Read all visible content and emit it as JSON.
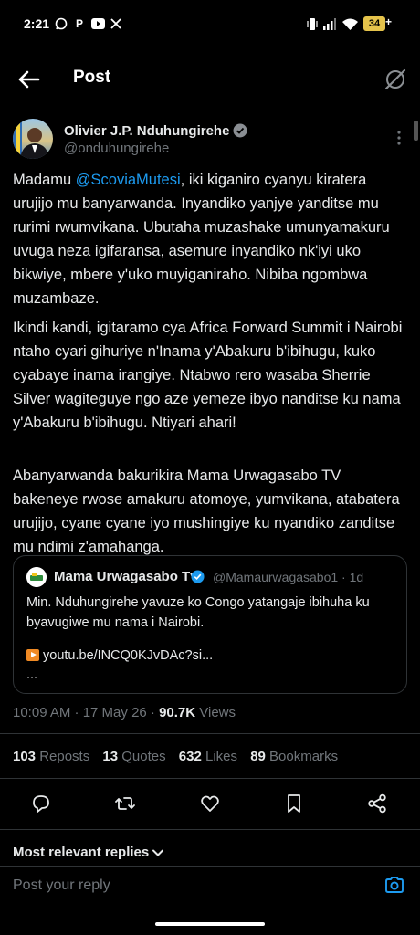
{
  "status_bar": {
    "time": "2:21",
    "battery": "34",
    "battery_suffix": "+",
    "app_icons": [
      "whatsapp-icon",
      "p-icon",
      "youtube-icon",
      "x-icon"
    ]
  },
  "header": {
    "title": "Post"
  },
  "author": {
    "name": "Olivier J.P. Nduhungirehe",
    "handle": "@onduhungirehe",
    "verified": true
  },
  "post": {
    "p1_prefix": "Madamu ",
    "p1_mention": "@ScoviaMutesi",
    "p1_rest": ", iki kiganiro cyanyu kiratera urujijo mu banyarwanda. Inyandiko yanjye yanditse mu rurimi rwumvikana. Ubutaha muzashake umunyamakuru uvuga neza igifaransa, asemure inyandiko nk'iyi uko bikwiye, mbere y'uko muyiganiraho. Nibiba ngombwa muzambaze.",
    "p2": "Ikindi kandi, igitaramo cya Africa Forward Summit i Nairobi ntaho cyari gihuriye n'Inama y'Abakuru b'ibihugu, kuko cyabaye inama irangiye. Ntabwo rero wasaba Sherrie Silver wagiteguye ngo aze yemeze ibyo nanditse ku nama y'Abakuru b'ibihugu. Ntiyari ahari!",
    "p3": "Abanyarwanda bakurikira Mama Urwagasabo TV bakeneye rwose amakuru atomoye, yumvikana, atabatera urujijo, cyane cyane iyo mushingiye ku nyandiko zanditse mu ndimi z'amahanga."
  },
  "quote": {
    "name": "Mama Urwagasabo Tv",
    "handle_time": "@Mamaurwagasabo1 · 1d",
    "text": "Min. Nduhungirehe yavuze ko Congo yatangaje ibihuha ku byavugiwe mu nama i Nairobi.",
    "link": "youtu.be/INCQ0KJvDAc?si...",
    "ellipsis": "..."
  },
  "meta": {
    "time_date": "10:09 AM · 17 May 26 · ",
    "views_count": "90.7K",
    "views_label": " Views"
  },
  "stats": {
    "reposts_count": "103",
    "reposts_label": " Reposts",
    "quotes_count": "13",
    "quotes_label": " Quotes",
    "likes_count": "632",
    "likes_label": " Likes",
    "bookmarks_count": "89",
    "bookmarks_label": " Bookmarks"
  },
  "actions": [
    "reply-icon",
    "repost-icon",
    "like-icon",
    "bookmark-icon",
    "share-icon"
  ],
  "replies": {
    "sort_label": "Most relevant replies"
  },
  "composer": {
    "placeholder": "Post your reply"
  },
  "colors": {
    "background": "#000000",
    "text": "#e7e9ea",
    "muted": "#71767b",
    "link": "#1d9bf0",
    "divider": "#2f3336"
  }
}
